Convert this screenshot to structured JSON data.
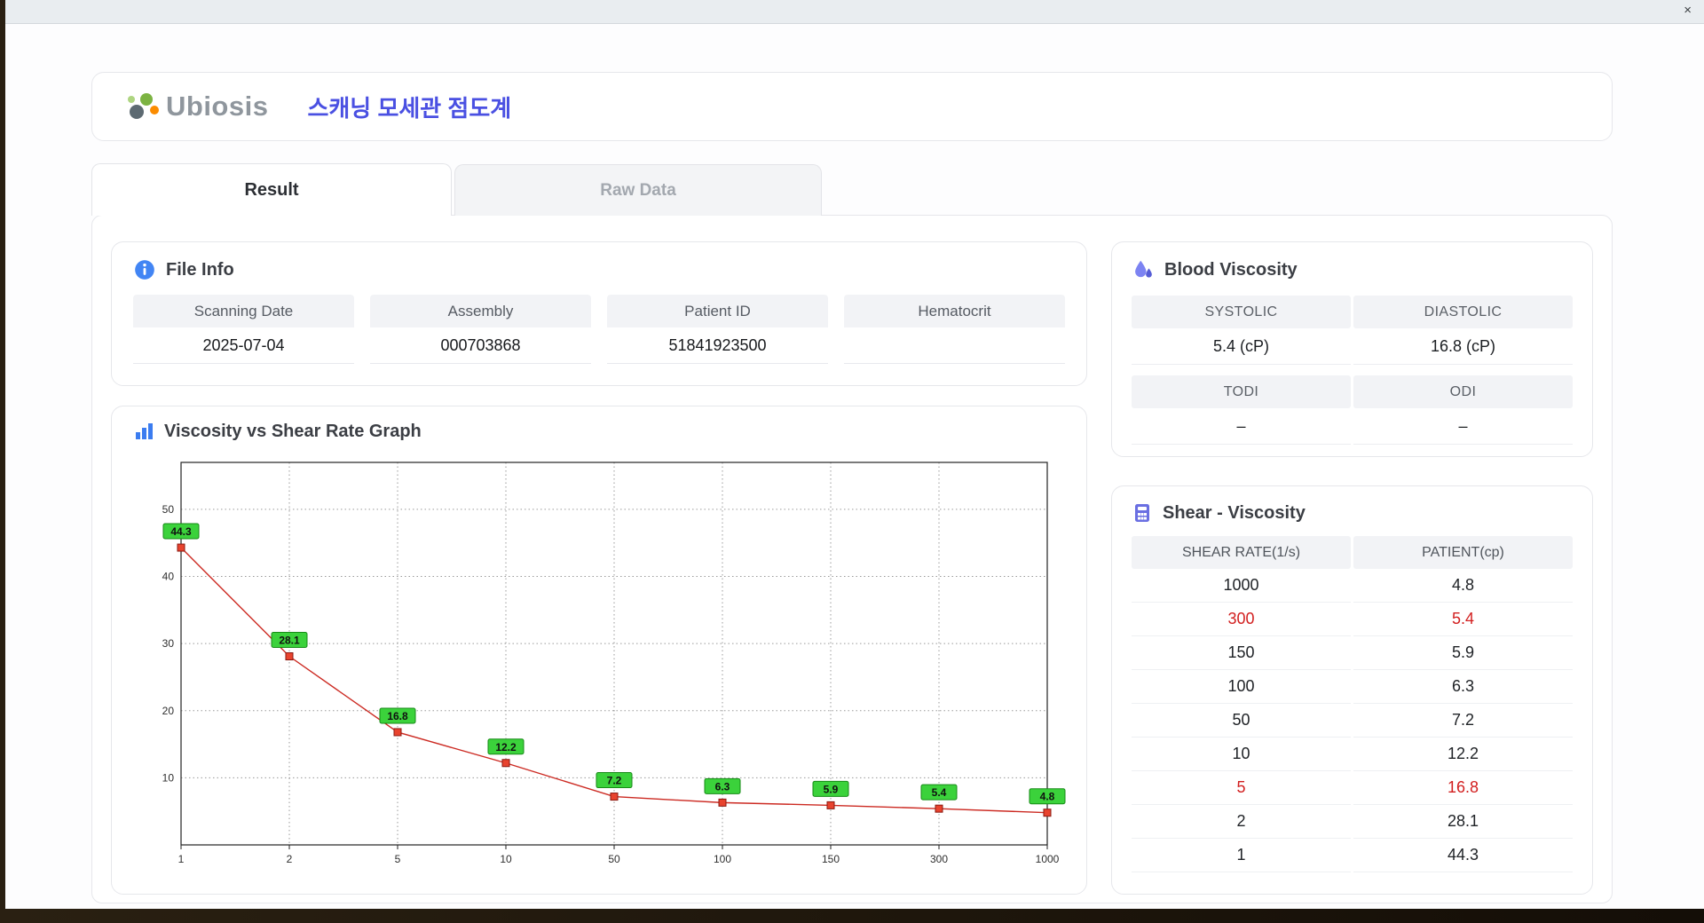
{
  "window": {
    "close_label": "×"
  },
  "header": {
    "logo_text": "Ubiosis",
    "title": "스캐닝 모세관 점도계"
  },
  "tabs": [
    {
      "label": "Result",
      "active": true
    },
    {
      "label": "Raw Data",
      "active": false
    }
  ],
  "file_info": {
    "title": "File Info",
    "fields": [
      {
        "label": "Scanning Date",
        "value": "2025-07-04"
      },
      {
        "label": "Assembly",
        "value": "000703868"
      },
      {
        "label": "Patient ID",
        "value": "51841923500"
      },
      {
        "label": "Hematocrit",
        "value": ""
      }
    ]
  },
  "graph": {
    "title": "Viscosity vs Shear Rate Graph"
  },
  "chart_data": {
    "type": "line",
    "title": "Viscosity vs Shear Rate Graph",
    "xlabel": "",
    "ylabel": "",
    "x_labels": [
      "1",
      "2",
      "5",
      "10",
      "50",
      "100",
      "150",
      "300",
      "1000"
    ],
    "values": [
      44.3,
      28.1,
      16.8,
      12.2,
      7.2,
      6.3,
      5.9,
      5.4,
      4.8
    ],
    "y_ticks": [
      10,
      20,
      30,
      40,
      50
    ],
    "ylim": [
      0,
      57
    ],
    "x_axis_type": "categorical (log-style tick labels, equally spaced)",
    "grid": "dotted",
    "legend": "none",
    "line_color": "#cc2a22",
    "marker_color": "#e8432e",
    "marker_edge_color": "#8a1810",
    "label_bg": "#3bd23b",
    "label_border": "#168a16"
  },
  "blood_viscosity": {
    "title": "Blood Viscosity",
    "rows": [
      {
        "headers": [
          "SYSTOLIC",
          "DIASTOLIC"
        ],
        "values": [
          "5.4 (cP)",
          "16.8 (cP)"
        ]
      },
      {
        "headers": [
          "TODI",
          "ODI"
        ],
        "values": [
          "–",
          "–"
        ]
      }
    ]
  },
  "shear_viscosity": {
    "title": "Shear - Viscosity",
    "columns": [
      "SHEAR RATE(1/s)",
      "PATIENT(cp)"
    ],
    "highlight_color": "#d21f1f",
    "rows": [
      {
        "shear": "1000",
        "patient": "4.8",
        "highlight": false
      },
      {
        "shear": "300",
        "patient": "5.4",
        "highlight": true
      },
      {
        "shear": "150",
        "patient": "5.9",
        "highlight": false
      },
      {
        "shear": "100",
        "patient": "6.3",
        "highlight": false
      },
      {
        "shear": "50",
        "patient": "7.2",
        "highlight": false
      },
      {
        "shear": "10",
        "patient": "12.2",
        "highlight": false
      },
      {
        "shear": "5",
        "patient": "16.8",
        "highlight": true
      },
      {
        "shear": "2",
        "patient": "28.1",
        "highlight": false
      },
      {
        "shear": "1",
        "patient": "44.3",
        "highlight": false
      }
    ]
  }
}
